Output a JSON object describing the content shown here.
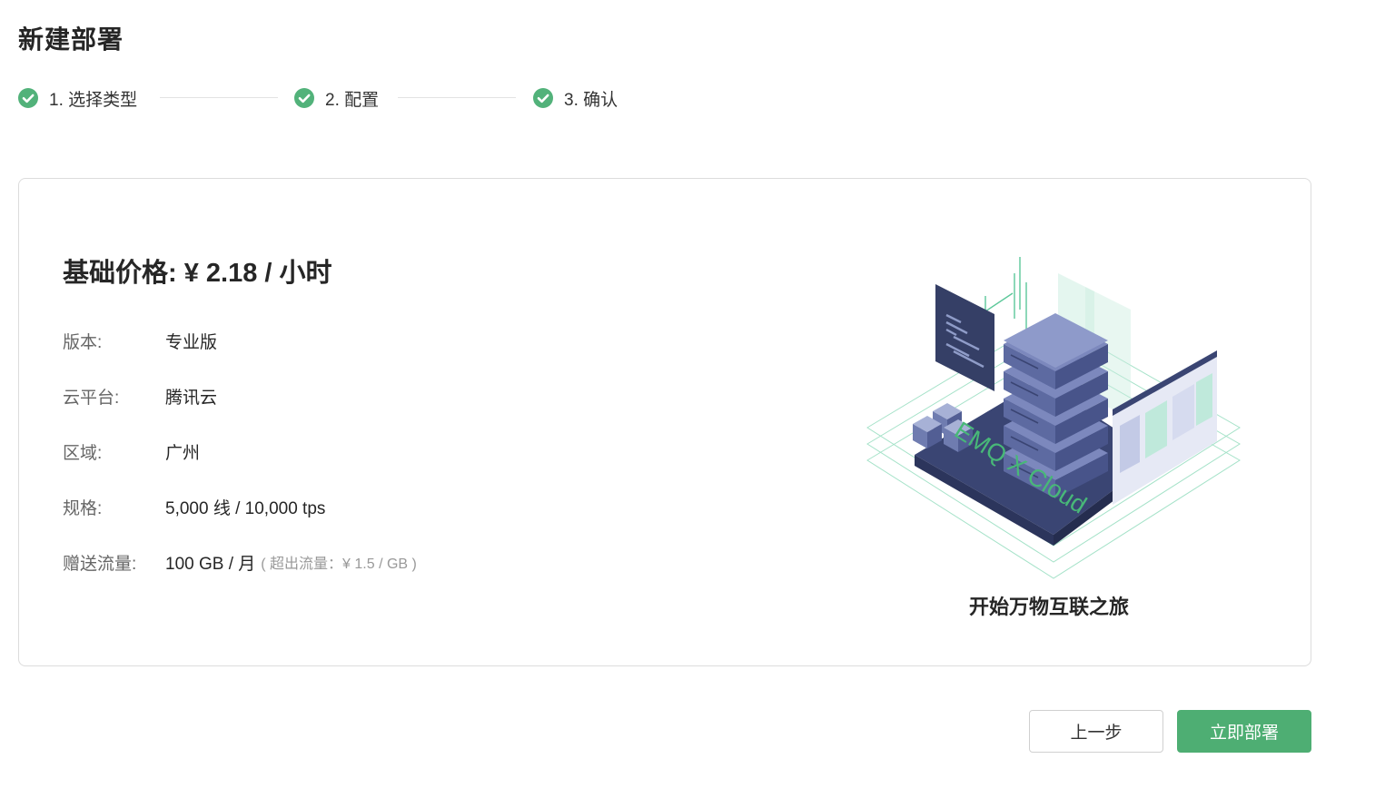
{
  "page": {
    "title": "新建部署"
  },
  "steps": [
    {
      "label": "1. 选择类型",
      "status": "done"
    },
    {
      "label": "2. 配置",
      "status": "done"
    },
    {
      "label": "3. 确认",
      "status": "done"
    }
  ],
  "summary": {
    "price_title": "基础价格: ¥ 2.18 / 小时",
    "rows": [
      {
        "key": "版本:",
        "value": "专业版"
      },
      {
        "key": "云平台:",
        "value": "腾讯云"
      },
      {
        "key": "区域:",
        "value": "广州"
      },
      {
        "key": "规格:",
        "value": "5,000 线 / 10,000 tps"
      },
      {
        "key": "赠送流量:",
        "value": "100 GB / 月",
        "extra": "( 超出流量：¥ 1.5 / GB )"
      }
    ]
  },
  "illustration": {
    "brand_text": "EMQ X Cloud",
    "slogan": "开始万物互联之旅"
  },
  "actions": {
    "prev_label": "上一步",
    "deploy_label": "立即部署"
  },
  "colors": {
    "accent": "#4eae73",
    "check": "#52b27a",
    "server": "#6f7cb0",
    "server_dark": "#3c4674",
    "panel_dark": "#353f66",
    "line": "#7fd6b2"
  },
  "icons": {
    "step_status": "check-circle-icon"
  }
}
